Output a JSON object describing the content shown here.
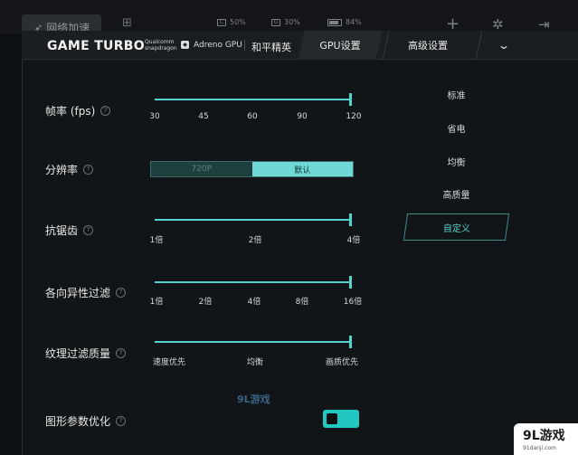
{
  "topbar": {
    "network_label": "网络加速",
    "cpu": "50%",
    "gpu": "30%",
    "battery": "84%"
  },
  "header": {
    "brand": "GAME TURBO",
    "qualcomm_line1": "Qualcomm",
    "qualcomm_line2": "snapdragon",
    "adreno": "Adreno GPU",
    "game": "和平精英",
    "tabs": [
      {
        "label": "GPU设置",
        "active": true
      },
      {
        "label": "高级设置",
        "active": false
      }
    ]
  },
  "settings": {
    "fps": {
      "label": "帧率 (fps)",
      "ticks": [
        "30",
        "45",
        "60",
        "90",
        "120"
      ],
      "value": "120"
    },
    "resolution": {
      "label": "分辨率",
      "options": [
        "720P",
        "默认"
      ],
      "selected": "默认"
    },
    "antialias": {
      "label": "抗锯齿",
      "ticks": [
        "1倍",
        "2倍",
        "4倍"
      ],
      "value": "4倍"
    },
    "anisotropic": {
      "label": "各向异性过滤",
      "ticks": [
        "1倍",
        "2倍",
        "4倍",
        "8倍",
        "16倍"
      ],
      "value": "16倍"
    },
    "texture": {
      "label": "纹理过滤质量",
      "ticks": [
        "速度优先",
        "均衡",
        "画质优先"
      ],
      "value": "画质优先"
    },
    "graphics_opt": {
      "label": "图形参数优化",
      "enabled": true
    }
  },
  "presets": [
    "标准",
    "省电",
    "均衡",
    "高质量",
    "自定义"
  ],
  "selected_preset": "自定义",
  "watermark": {
    "center": "9L游戏",
    "corner": "9L游戏",
    "corner_url": "91danji.com"
  },
  "colors": {
    "accent": "#55d4cf"
  }
}
